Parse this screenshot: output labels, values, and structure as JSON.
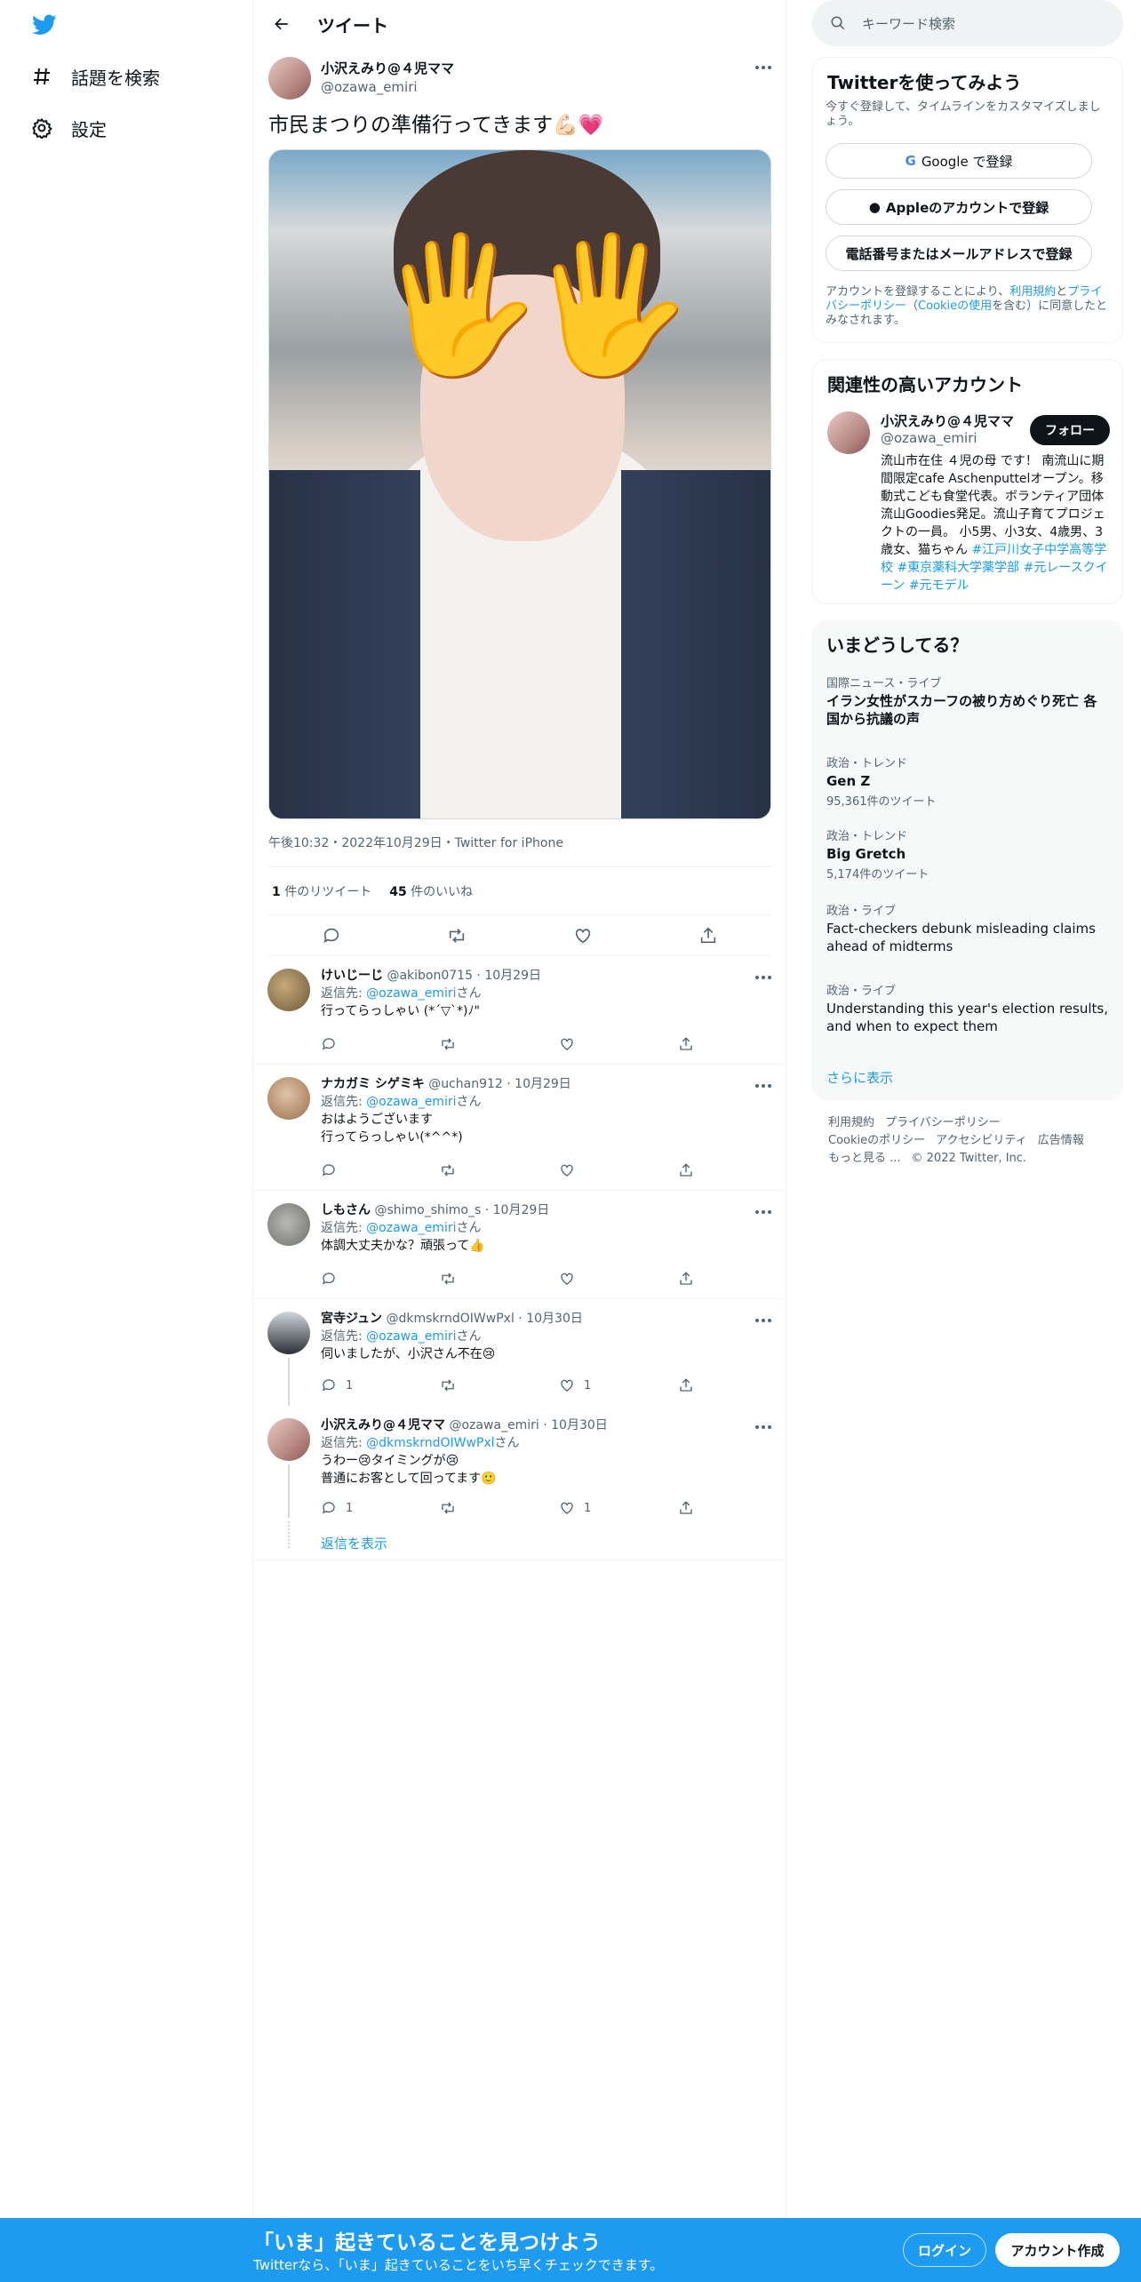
{
  "nav": {
    "logo": "twitter-bird",
    "items": [
      {
        "label": "話題を検索",
        "icon": "hashtag-icon"
      },
      {
        "label": "設定",
        "icon": "gear-icon"
      }
    ]
  },
  "header": {
    "title": "ツイート"
  },
  "tweet": {
    "author_name": "小沢えみり@４児ママ",
    "author_handle": "@ozawa_emiri",
    "text": "市民まつりの準備行ってきます💪🏻💗",
    "meta": "午後10:32・2022年10月29日・Twitter for iPhone",
    "retweets_count": "1",
    "retweets_label": "件のリツイート",
    "likes_count": "45",
    "likes_label": "件のいいね"
  },
  "replies": [
    {
      "name": "けいじーじ",
      "handle": "@akibon0715",
      "date": "10月29日",
      "reply_to_prefix": "返信先: ",
      "reply_to": "@ozawa_emiri",
      "reply_to_suffix": "さん",
      "lines": [
        "行ってらっしゃい (*´▽`*)ﾉ\""
      ],
      "replies": "",
      "likes": ""
    },
    {
      "name": "ナカガミ シゲミキ",
      "handle": "@uchan912",
      "date": "10月29日",
      "reply_to_prefix": "返信先: ",
      "reply_to": "@ozawa_emiri",
      "reply_to_suffix": "さん",
      "lines": [
        "おはようございます",
        "行ってらっしゃい(*^^*)"
      ],
      "replies": "",
      "likes": ""
    },
    {
      "name": "しもさん",
      "handle": "@shimo_shimo_s",
      "date": "10月29日",
      "reply_to_prefix": "返信先: ",
      "reply_to": "@ozawa_emiri",
      "reply_to_suffix": "さん",
      "lines": [
        "体調大丈夫かな？頑張って👍"
      ],
      "replies": "",
      "likes": ""
    },
    {
      "name": "宮寺ジュン",
      "handle": "@dkmskrndOIWwPxl",
      "date": "10月30日",
      "reply_to_prefix": "返信先: ",
      "reply_to": "@ozawa_emiri",
      "reply_to_suffix": "さん",
      "lines": [
        "伺いましたが、小沢さん不在😢"
      ],
      "replies": "1",
      "likes": "1"
    },
    {
      "name": "小沢えみり@４児ママ",
      "handle": "@ozawa_emiri",
      "date": "10月30日",
      "reply_to_prefix": "返信先: ",
      "reply_to": "@dkmskrndOIWwPxl",
      "reply_to_suffix": "さん",
      "lines": [
        "うわー😢タイミングが😢",
        "普通にお客として回ってます🙂"
      ],
      "replies": "1",
      "likes": "1"
    }
  ],
  "show_replies": "返信を表示",
  "right": {
    "search_placeholder": "キーワード検索",
    "signup": {
      "title": "Twitterを使ってみよう",
      "subtitle": "今すぐ登録して、タイムラインをカスタマイズしましょう。",
      "google_btn": "Google で登録",
      "apple_btn": "Appleのアカウントで登録",
      "phone_btn": "電話番号またはメールアドレスで登録",
      "terms_1": "アカウントを登録することにより、",
      "terms_link1": "利用規約",
      "terms_2": "と",
      "terms_link2": "プライバシーポリシー",
      "terms_3": "（",
      "terms_link3": "Cookieの使用",
      "terms_4": "を含む）に同意したとみなされます。"
    },
    "related": {
      "title": "関連性の高いアカウント",
      "name": "小沢えみり@４児ママ",
      "handle": "@ozawa_emiri",
      "follow": "フォロー",
      "bio": "流山市在住 ４児の母 です！ 南流山に期間限定cafe Aschenputtelオープン。移動式こども食堂代表。ボランティア団体流山Goodies発足。流山子育てプロジェクトの一員。 小5男、小3女、4歳男、3歳女、猫ちゃん ",
      "bio_links": "#江戸川女子中学高等学校 #東京薬科大学薬学部 #元レースクイーン #元モデル"
    },
    "trends": {
      "title": "いまどうしてる？",
      "items": [
        {
          "category": "国際ニュース・ライブ",
          "title": "イラン女性がスカーフの被り方めぐり死亡 各国から抗議の声",
          "count": ""
        },
        {
          "category": "政治・トレンド",
          "title": "Gen Z",
          "count": "95,361件のツイート"
        },
        {
          "category": "政治・トレンド",
          "title": "Big Gretch",
          "count": "5,174件のツイート"
        },
        {
          "category": "政治・ライブ",
          "title": "Fact-checkers debunk misleading claims ahead of midterms",
          "count": ""
        },
        {
          "category": "政治・ライブ",
          "title": "Understanding this year's election results, and when to expect them",
          "count": ""
        }
      ],
      "more": "さらに表示"
    },
    "footer": {
      "line1": [
        "利用規約",
        "プライバシーポリシー"
      ],
      "line2": [
        "Cookieのポリシー",
        "アクセシビリティ",
        "広告情報"
      ],
      "line3": [
        "もっと見る ...",
        "© 2022 Twitter, Inc."
      ]
    }
  },
  "bottombar": {
    "title": "「いま」起きていることを見つけよう",
    "subtitle": "Twitterなら、「いま」起きていることをいち早くチェックできます。",
    "login": "ログイン",
    "signup": "アカウント作成"
  },
  "colors": {
    "accent": "#1d9bf0",
    "text": "#0f1419",
    "muted": "#536471"
  }
}
